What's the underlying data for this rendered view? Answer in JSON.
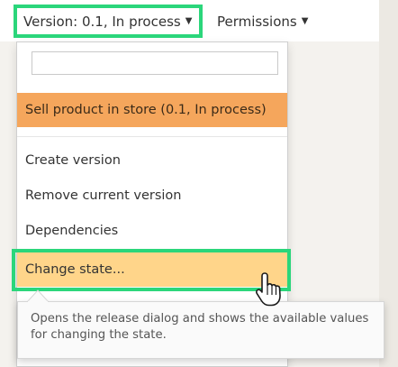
{
  "toolbar": {
    "version_menu_label": "Version: 0.1, In process",
    "permissions_menu_label": "Permissions"
  },
  "version_dropdown": {
    "search": {
      "value": "",
      "placeholder": ""
    },
    "selected_item": "Sell product in store (0.1, In process)",
    "items": [
      "Create version",
      "Remove current version",
      "Dependencies",
      "Change state..."
    ]
  },
  "tooltip": {
    "text": "Opens the release dialog and shows the available values for changing the state."
  },
  "colors": {
    "highlight_frame": "#2bd67b",
    "selected_item_bg": "#f5a65c",
    "hover_item_bg": "#ffd58a"
  },
  "icons": {
    "menu_caret": "caret-down-icon",
    "cursor": "hand-pointer-icon"
  }
}
